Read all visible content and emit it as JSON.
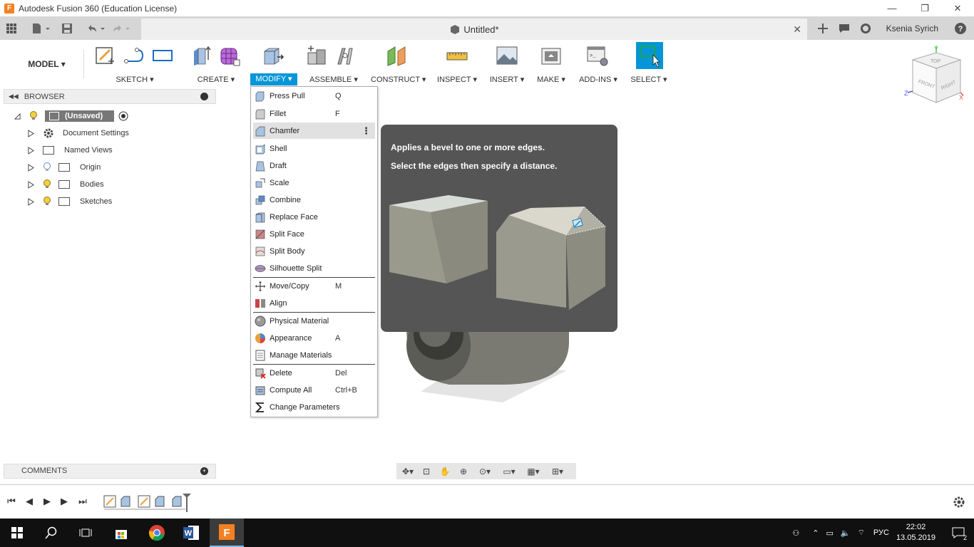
{
  "window": {
    "title": "Autodesk Fusion 360 (Education License)",
    "logo_letter": "F",
    "minimize": "—",
    "restore": "❐",
    "close": "✕"
  },
  "tabstrip": {
    "doc_title": "Untitled*",
    "close": "✕",
    "user": "Ksenia Syrich"
  },
  "toolbar": {
    "workspace": "MODEL ▾",
    "groups": [
      {
        "label": "SKETCH ▾"
      },
      {
        "label": "CREATE ▾"
      },
      {
        "label": "MODIFY ▾"
      },
      {
        "label": "ASSEMBLE ▾"
      },
      {
        "label": "CONSTRUCT ▾"
      },
      {
        "label": "INSPECT ▾"
      },
      {
        "label": "INSERT ▾"
      },
      {
        "label": "MAKE ▾"
      },
      {
        "label": "ADD-INS ▾"
      },
      {
        "label": "SELECT ▾"
      }
    ],
    "active_color": "#0696d7"
  },
  "browser": {
    "title": "BROWSER",
    "root": "(Unsaved)",
    "items": [
      {
        "label": "Document Settings"
      },
      {
        "label": "Named Views"
      },
      {
        "label": "Origin"
      },
      {
        "label": "Bodies"
      },
      {
        "label": "Sketches"
      }
    ]
  },
  "comments": {
    "title": "COMMENTS"
  },
  "modify_menu": {
    "items": [
      {
        "label": "Press Pull",
        "shortcut": "Q"
      },
      {
        "label": "Fillet",
        "shortcut": "F"
      },
      {
        "label": "Chamfer",
        "shortcut": ""
      },
      {
        "label": "Shell",
        "shortcut": ""
      },
      {
        "label": "Draft",
        "shortcut": ""
      },
      {
        "label": "Scale",
        "shortcut": ""
      },
      {
        "label": "Combine",
        "shortcut": ""
      },
      {
        "label": "Replace Face",
        "shortcut": ""
      },
      {
        "label": "Split Face",
        "shortcut": ""
      },
      {
        "label": "Split Body",
        "shortcut": ""
      },
      {
        "label": "Silhouette Split",
        "shortcut": ""
      },
      {
        "label": "Move/Copy",
        "shortcut": "M"
      },
      {
        "label": "Align",
        "shortcut": ""
      },
      {
        "label": "Physical Material",
        "shortcut": ""
      },
      {
        "label": "Appearance",
        "shortcut": "A"
      },
      {
        "label": "Manage Materials",
        "shortcut": ""
      },
      {
        "label": "Delete",
        "shortcut": "Del"
      },
      {
        "label": "Compute All",
        "shortcut": "Ctrl+B"
      },
      {
        "label": "Change Parameters",
        "shortcut": ""
      }
    ],
    "highlighted": "Chamfer",
    "more": "⋮"
  },
  "tooltip": {
    "title": "Applies a bevel to one or more edges.",
    "description": "Select the edges then specify a distance."
  },
  "viewcube": {
    "top": "TOP",
    "front": "FRONT",
    "right": "RIGHT",
    "x": "X",
    "y": "Y",
    "z": "Z"
  },
  "taskbar": {
    "language": "РУС",
    "time": "22:02",
    "date": "13.05.2019",
    "notifications": "2"
  }
}
